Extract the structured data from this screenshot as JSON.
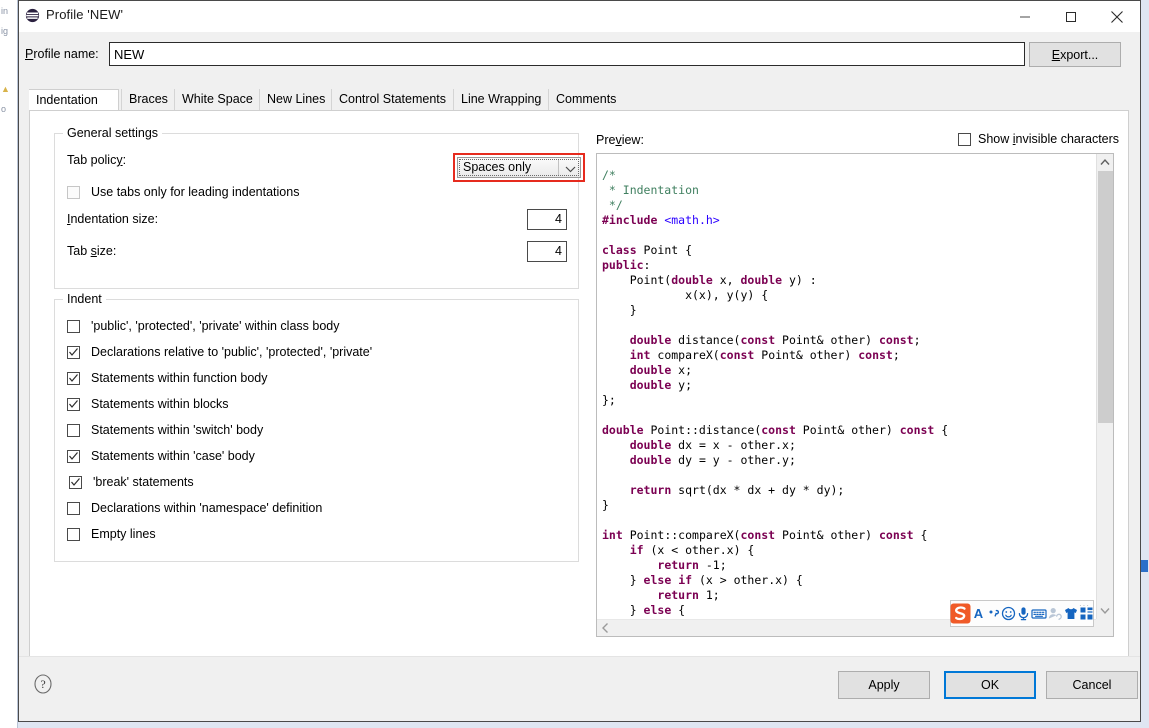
{
  "window": {
    "title": "Profile 'NEW'",
    "icon": "eclipse-icon",
    "minimize_label": "Minimize",
    "maximize_label": "Maximize",
    "close_label": "Close"
  },
  "profile": {
    "label": "Profile name:",
    "value": "NEW",
    "placeholder": "",
    "export_label": "Export..."
  },
  "tabs": [
    {
      "label": "Indentation",
      "selected": true
    },
    {
      "label": "Braces",
      "selected": false
    },
    {
      "label": "White Space",
      "selected": false
    },
    {
      "label": "New Lines",
      "selected": false
    },
    {
      "label": "Control Statements",
      "selected": false
    },
    {
      "label": "Line Wrapping",
      "selected": false
    },
    {
      "label": "Comments",
      "selected": false
    }
  ],
  "general_settings": {
    "legend": "General settings",
    "tab_policy_label": "Tab policy:",
    "tab_policy_value": "Spaces only",
    "tab_policy_highlight_color": "#e62b1e",
    "use_tabs_label": "Use tabs only for leading indentations",
    "use_tabs_checked": false,
    "use_tabs_enabled": false,
    "indentation_size_label": "Indentation size:",
    "indentation_size_value": "4",
    "tab_size_label": "Tab size:",
    "tab_size_value": "4"
  },
  "indent_group": {
    "legend": "Indent",
    "items": [
      {
        "label": "'public', 'protected', 'private' within class body",
        "checked": false
      },
      {
        "label": "Declarations relative to 'public', 'protected', 'private'",
        "checked": true
      },
      {
        "label": "Statements within function body",
        "checked": true
      },
      {
        "label": "Statements within blocks",
        "checked": true
      },
      {
        "label": "Statements within 'switch' body",
        "checked": false
      },
      {
        "label": "Statements within 'case' body",
        "checked": true
      },
      {
        "label": "'break' statements",
        "checked": true
      },
      {
        "label": "Declarations within 'namespace' definition",
        "checked": false
      },
      {
        "label": "Empty lines",
        "checked": false
      }
    ]
  },
  "preview": {
    "label": "Preview:",
    "show_invisible_label": "Show invisible characters",
    "show_invisible_checked": false,
    "code_lines": [
      "/*",
      " * Indentation",
      " */",
      "#include <math.h>",
      "",
      "class Point {",
      "public:",
      "    Point(double x, double y) :",
      "            x(x), y(y) {",
      "    }",
      "",
      "    double distance(const Point& other) const;",
      "    int compareX(const Point& other) const;",
      "    double x;",
      "    double y;",
      "};",
      "",
      "double Point::distance(const Point& other) const {",
      "    double dx = x - other.x;",
      "    double dy = y - other.y;",
      "",
      "    return sqrt(dx * dx + dy * dy);",
      "}",
      "",
      "int Point::compareX(const Point& other) const {",
      "    if (x < other.x) {",
      "        return -1;",
      "    } else if (x > other.x) {",
      "        return 1;",
      "    } else {"
    ],
    "keyword_color": "#7b0052",
    "comment_color": "#3f7f5f",
    "include_color": "#2a00ff"
  },
  "ime_toolbar": {
    "items": [
      {
        "name": "sogou-logo-icon",
        "label": "S"
      },
      {
        "name": "input-mode-letter-icon",
        "label": "A"
      },
      {
        "name": "punctuation-icon",
        "label": ","
      },
      {
        "name": "emoji-icon",
        "label": "smiley"
      },
      {
        "name": "voice-input-icon",
        "label": "microphone"
      },
      {
        "name": "soft-keyboard-icon",
        "label": "keyboard"
      },
      {
        "name": "handwriting-icon",
        "label": "handwriting"
      },
      {
        "name": "skin-icon",
        "label": "shirt"
      },
      {
        "name": "toolbox-icon",
        "label": "grid"
      }
    ]
  },
  "footer": {
    "help_label": "?",
    "apply_label": "Apply",
    "ok_label": "OK",
    "cancel_label": "Cancel",
    "focus_color": "#0078d7"
  }
}
